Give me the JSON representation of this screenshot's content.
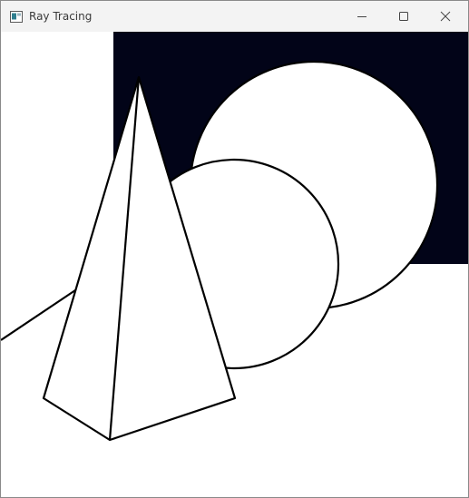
{
  "window": {
    "title": "Ray Tracing",
    "controls": {
      "minimize_icon": "minimize-icon",
      "maximize_icon": "maximize-icon",
      "close_icon": "close-icon"
    }
  },
  "scene": {
    "background_color": "#020418",
    "fill_color": "#ffffff",
    "outline_color": "#000000",
    "objects": [
      "pyramid",
      "large-sphere",
      "small-sphere",
      "floor-edge"
    ]
  }
}
